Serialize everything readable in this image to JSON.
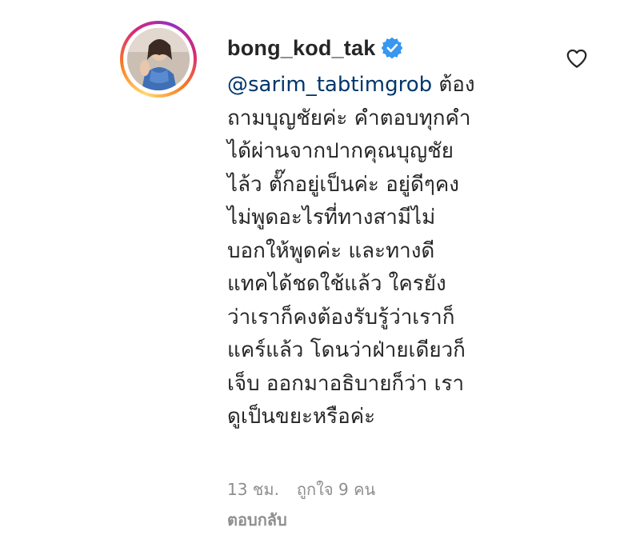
{
  "comment": {
    "username": "bong_kod_tak",
    "verified": true,
    "mention": "@sarim_tabtimgrob",
    "text": " ต้องถามบุญชัยค่ะ คำตอบทุกคำได้ผ่านจากปากคุณบุญชัยไล้ว ตั๊กอยู่เป็นค่ะ อยู่ดีๆคงไม่พูดอะไรที่ทางสามีไม่บอกให้พูดค่ะ และทางดีแทคได้ชดใช้แล้ว ใครยังว่าเราก็คงต้องรับรู้ว่าเราก็แคร์แล้ว โดนว่าฝ่ายเดียวก็เจ็บ ออกมาอธิบายก็ว่า เราดูเป็นขยะหรือค่ะ",
    "lines": [
      "ต้อง",
      "ถามบุญชัยค่ะ คำตอบทุกคำ",
      "ได้ผ่านจากปากคุณบุญชัย",
      "ไล้ว ตั๊กอยู่เป็นค่ะ อยู่ดีๆคง",
      "ไม่พูดอะไรที่ทางสามีไม่",
      "บอกให้พูดค่ะ และทางดี",
      "แทคได้ชดใช้แล้ว ใครยัง",
      "ว่าเราก็คงต้องรับรู้ว่าเราก็",
      "แคร์แล้ว โดนว่าฝ่ายเดียวก็",
      "เจ็บ ออกมาอธิบายก็ว่า เรา",
      "ดูเป็นขยะหรือค่ะ"
    ],
    "time": "13 ชม.",
    "likes": "ถูกใจ 9 คน",
    "reply_label": "ตอบกลับ"
  },
  "icons": {
    "avatar": "profile-photo",
    "verified": "verified-badge-icon",
    "like": "heart-outline-icon"
  },
  "colors": {
    "text": "#262626",
    "mention": "#00376b",
    "meta": "#8e8e8e",
    "verified": "#3897f0"
  }
}
